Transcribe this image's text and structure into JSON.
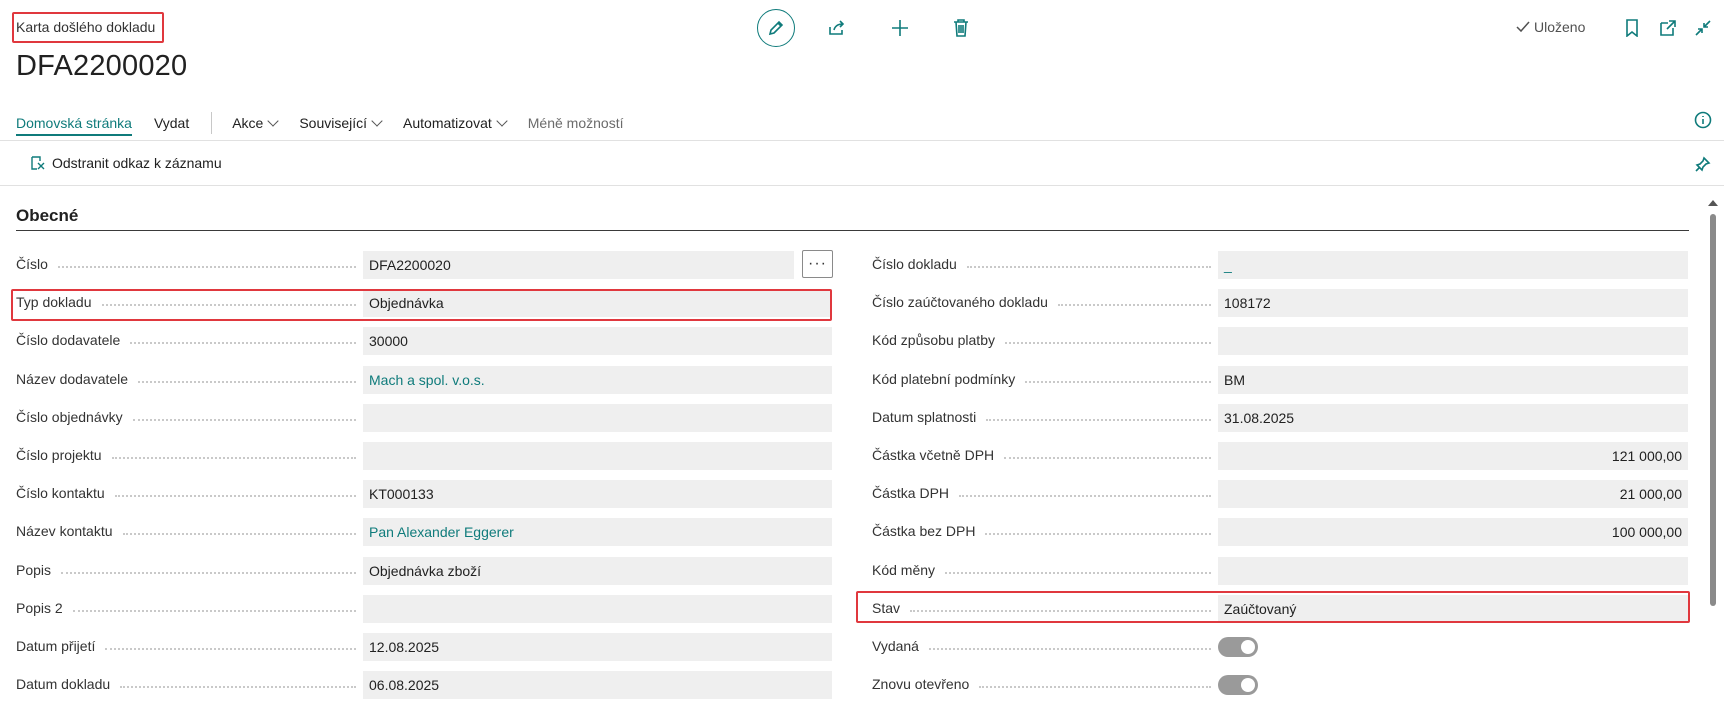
{
  "header": {
    "card_caption": "Karta došlého dokladu",
    "page_title": "DFA2200020",
    "saved_label": "Uloženo"
  },
  "icons": {
    "edit": "pencil-icon",
    "share": "share-icon",
    "new": "plus-icon",
    "delete": "trash-icon",
    "bookmark": "bookmark-icon",
    "open_new_window": "open-in-new-window-icon",
    "collapse": "collapse-icon",
    "info": "info-icon",
    "pin": "pin-icon"
  },
  "actionbar": {
    "tabs": [
      {
        "label": "Domovská stránka",
        "active": true
      },
      {
        "label": "Vydat"
      }
    ],
    "menus": [
      {
        "label": "Akce"
      },
      {
        "label": "Související"
      },
      {
        "label": "Automatizovat"
      }
    ],
    "less_options": "Méně možností"
  },
  "linkbar": {
    "remove_link_label": "Odstranit odkaz k záznamu"
  },
  "section": {
    "title": "Obecné"
  },
  "left_fields": [
    {
      "label": "Číslo",
      "value": "DFA2200020"
    },
    {
      "label": "Typ dokladu",
      "value": "Objednávka"
    },
    {
      "label": "Číslo dodavatele",
      "value": "30000"
    },
    {
      "label": "Název dodavatele",
      "value": "Mach a spol. v.o.s."
    },
    {
      "label": "Číslo objednávky",
      "value": ""
    },
    {
      "label": "Číslo projektu",
      "value": ""
    },
    {
      "label": "Číslo kontaktu",
      "value": "KT000133"
    },
    {
      "label": "Název kontaktu",
      "value": "Pan Alexander Eggerer"
    },
    {
      "label": "Popis",
      "value": "Objednávka zboží"
    },
    {
      "label": "Popis 2",
      "value": ""
    },
    {
      "label": "Datum přijetí",
      "value": "12.08.2025"
    },
    {
      "label": "Datum dokladu",
      "value": "06.08.2025"
    }
  ],
  "assist_button": "···",
  "right_fields": [
    {
      "label": "Číslo dokladu",
      "value": "_"
    },
    {
      "label": "Číslo zaúčtovaného dokladu",
      "value": "108172"
    },
    {
      "label": "Kód způsobu platby",
      "value": ""
    },
    {
      "label": "Kód platební podmínky",
      "value": "BM"
    },
    {
      "label": "Datum splatnosti",
      "value": "31.08.2025"
    },
    {
      "label": "Částka včetně DPH",
      "value": "121 000,00"
    },
    {
      "label": "Částka DPH",
      "value": "21 000,00"
    },
    {
      "label": "Částka bez DPH",
      "value": "100 000,00"
    },
    {
      "label": "Kód měny",
      "value": ""
    },
    {
      "label": "Stav",
      "value": "Zaúčtovaný"
    },
    {
      "label": "Vydaná",
      "value": true
    },
    {
      "label": "Znovu otevřeno",
      "value": true
    }
  ],
  "colors": {
    "accent": "#0f7b7b",
    "highlight_box": "#e0383e",
    "field_bg": "#efefef"
  }
}
